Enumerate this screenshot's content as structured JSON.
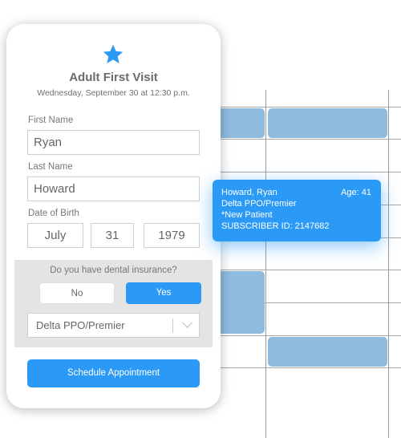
{
  "form": {
    "title": "Adult First Visit",
    "subtitle": "Wednesday, September 30 at 12:30 p.m.",
    "first_name_label": "First Name",
    "first_name": "Ryan",
    "last_name_label": "Last Name",
    "last_name": "Howard",
    "dob_label": "Date of Birth",
    "dob_month": "July",
    "dob_day": "31",
    "dob_year": "1979",
    "insurance_question": "Do you have dental insurance?",
    "no_label": "No",
    "yes_label": "Yes",
    "insurance_plan": "Delta PPO/Premier",
    "submit_label": "Schedule Appointment"
  },
  "tooltip": {
    "name": "Howard, Ryan",
    "age": "Age: 41",
    "plan": "Delta PPO/Premier",
    "status": "*New Patient",
    "subscriber": "SUBSCRIBER ID: 2147682"
  },
  "colors": {
    "accent": "#2b9af7",
    "booked_slot": "#8fbbdf"
  }
}
